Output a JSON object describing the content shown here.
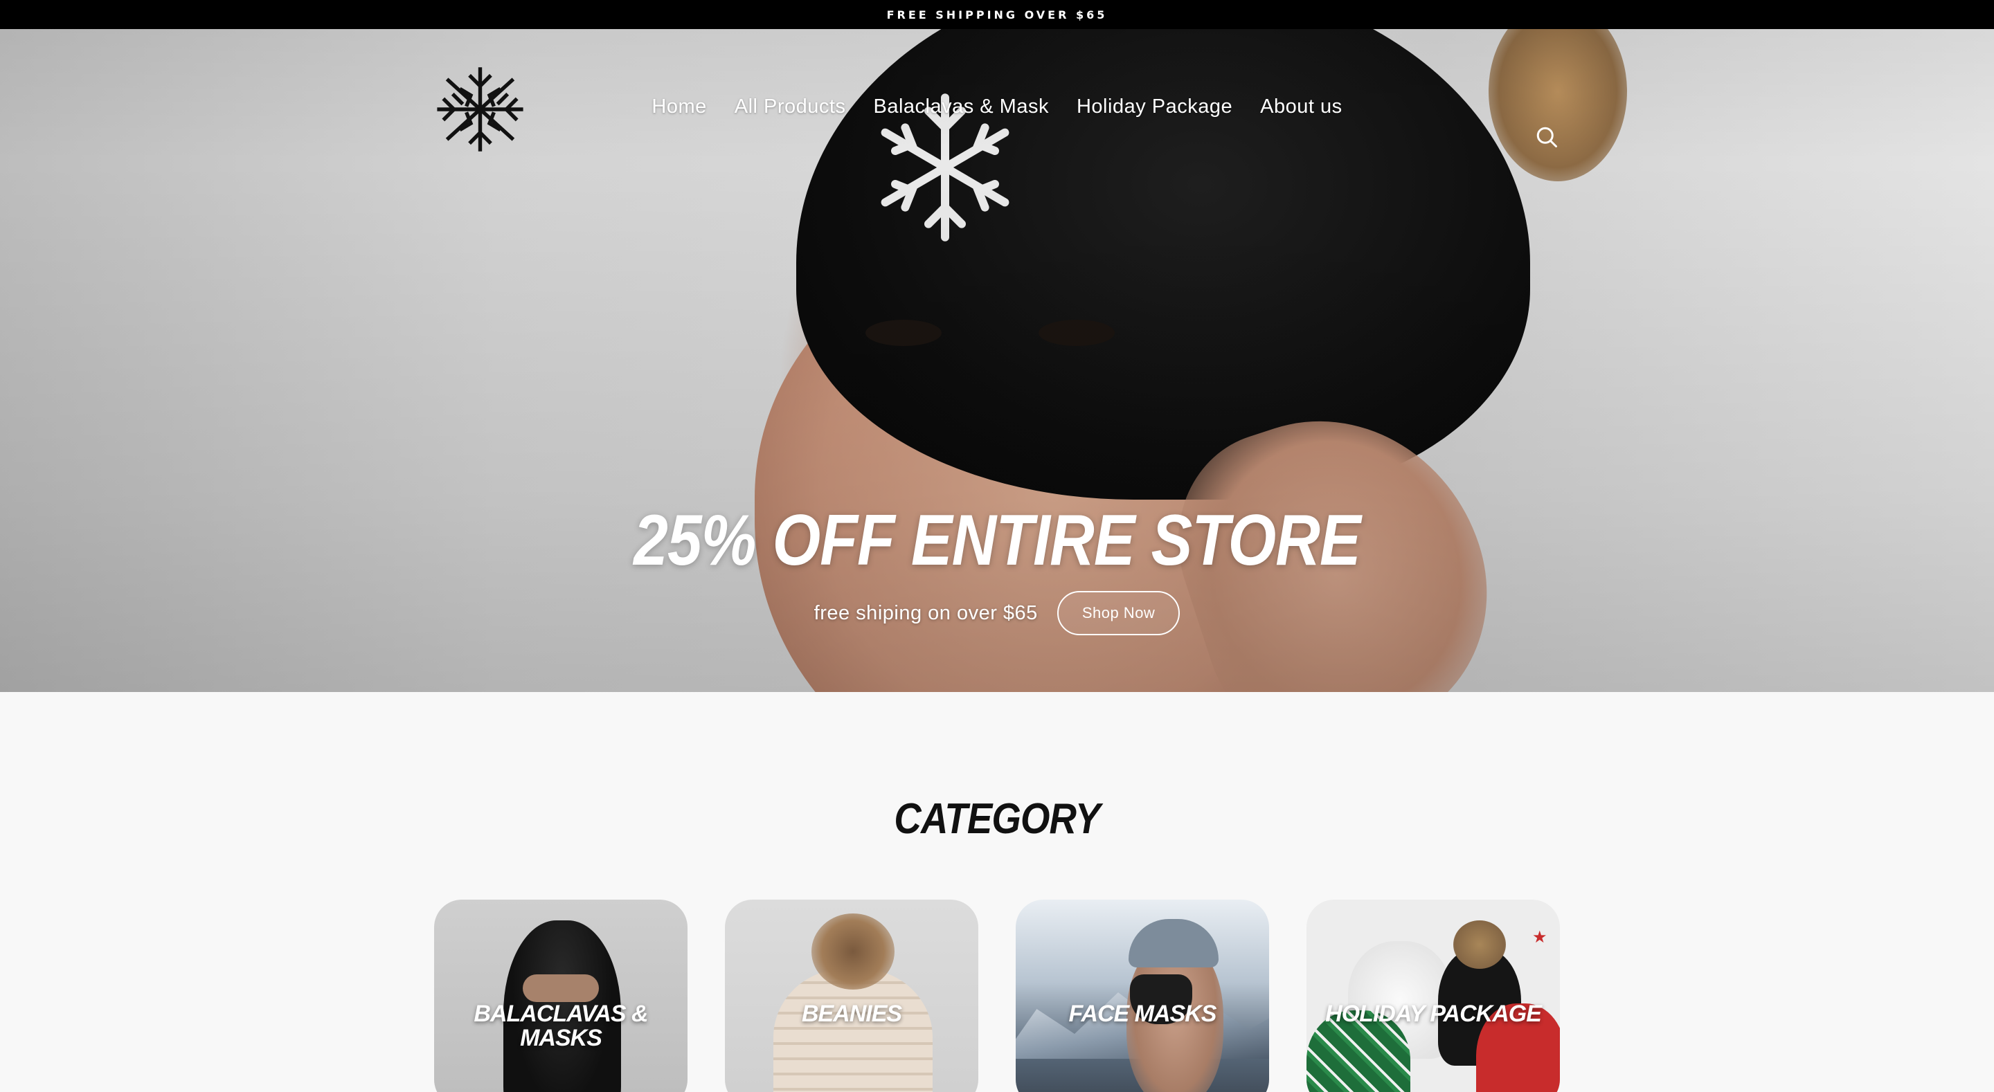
{
  "announcement": {
    "text": "FREE SHIPPING OVER $65"
  },
  "header": {
    "nav": [
      {
        "label": "Home"
      },
      {
        "label": "All Products"
      },
      {
        "label": "Balaclavas & Mask"
      },
      {
        "label": "Holiday Package"
      },
      {
        "label": "About us"
      }
    ],
    "search_icon": "search-icon",
    "logo_icon": "snowflake-logo"
  },
  "hero": {
    "title": "25% OFF ENTIRE STORE",
    "subtitle": "free shiping on over $65",
    "cta_label": "Shop Now"
  },
  "category": {
    "heading": "CATEGORY",
    "cards": [
      {
        "label": "BALACLAVAS & MASKS"
      },
      {
        "label": "BEANIES"
      },
      {
        "label": "FACE MASKS"
      },
      {
        "label": "HOLIDAY PACKAGE"
      }
    ]
  },
  "colors": {
    "announcement_bg": "#000000",
    "page_bg": "#f8f8f8",
    "text_dark": "#111111",
    "text_light": "#ffffff"
  }
}
